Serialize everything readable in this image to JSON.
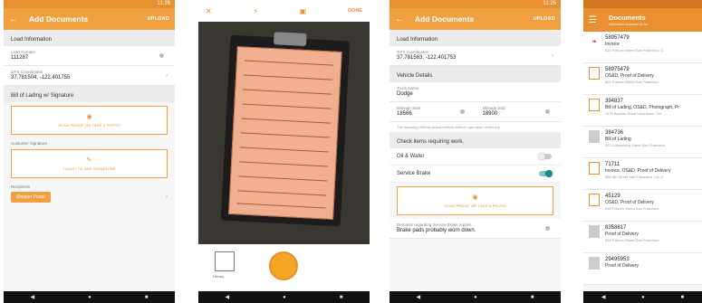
{
  "status_time": "11:26",
  "screen1": {
    "title": "Add Documents",
    "action": "UPLOAD",
    "section_load": "Load Information",
    "load_number_label": "Load Number",
    "load_number": "111287",
    "gps_label": "GPS Coordinates",
    "gps": "37.781504, -122.401755",
    "section_bol": "Bill of Lading w/ Signature",
    "photo_box": "SCAN PROOF OR TAKE A PHOTO",
    "customer_sig_label": "Customer Signature",
    "signature_box": "TOUCH TO ADD SIGNATURE",
    "recipients_label": "Recipients",
    "recipient_chip": "Shipper Portal"
  },
  "screen2": {
    "done": "DONE",
    "library_label": "Library"
  },
  "screen3": {
    "title": "Add Documents",
    "action": "UPLOAD",
    "section_load": "Load Information",
    "gps_label": "GPS Coordinates",
    "gps": "37.781563, -122.401753",
    "section_vehicle": "Vehicle Details",
    "truck_label": "Truck Name",
    "truck": "Dodge",
    "mileage_start_label": "Mileage Start",
    "mileage_start": "18566",
    "mileage_end_label": "Mileage End",
    "mileage_end": "18900",
    "mileage_note": "The following reflects actual vehicle miles in operation of this trip",
    "check_items": "Check items requiring work.",
    "oil_water": "Oil & Water",
    "service_brake": "Service Brake",
    "photo_box": "SCAN PROOF OR TAKE A PHOTO",
    "remarks_label": "Remarks regarding Service Brake repairs",
    "remarks": "Brake pads probably worn down."
  },
  "screen4": {
    "title": "Documents",
    "subtitle": "Uploaded documents for",
    "docs": [
      {
        "num": "58957479",
        "type": "Invoice",
        "addr": "616 Folsom Street San Francisco, C",
        "icon": "pdf"
      },
      {
        "num": "58975479",
        "type": "OS&D, Proof of Delivery",
        "addr": "621 Folsom Street San Francisco",
        "icon": "form"
      },
      {
        "num": "394837",
        "type": "Bill of Lading, OS&D, Photograph, Pr",
        "addr": "1475 Buckler Road Uniontown, OH",
        "icon": "form"
      },
      {
        "num": "384736",
        "type": "Bill of Lading",
        "addr": "313 Chinneking Street San Francisco",
        "icon": "img"
      },
      {
        "num": "71711",
        "type": "Invoice, OS&D, Proof of Delivery",
        "addr": "360 4th Street San Francisco, CA, 9",
        "icon": "form"
      },
      {
        "num": "45129",
        "type": "OS&D, Proof of Delivery",
        "addr": "616 Folsom Street San Francisco",
        "icon": "form"
      },
      {
        "num": "8358617",
        "type": "Proof of Delivery",
        "addr": "616 Folsom Street San Francisco",
        "icon": "img"
      },
      {
        "num": "29495953",
        "type": "Proof of Delivery",
        "addr": "",
        "icon": "img"
      }
    ]
  }
}
